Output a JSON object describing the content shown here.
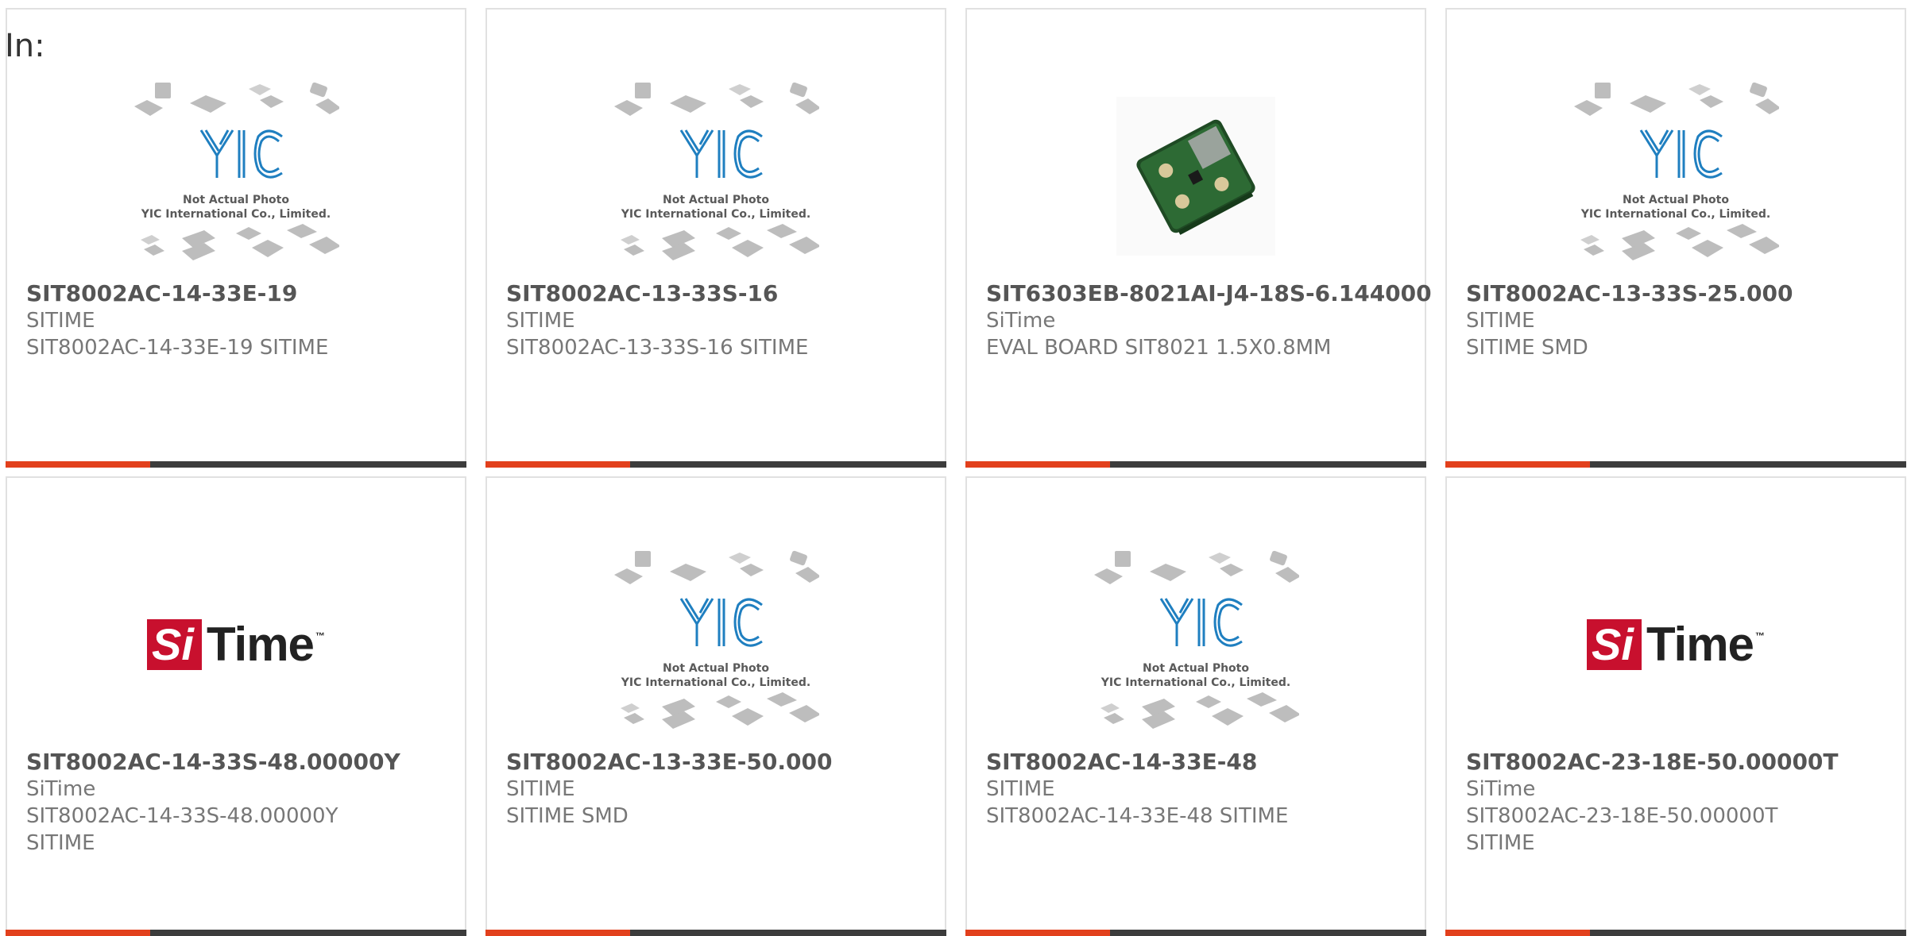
{
  "page": {
    "in_label": "In:"
  },
  "products": [
    {
      "part_number": "SIT8002AC-14-33E-19",
      "manufacturer": "SITIME",
      "description": "SIT8002AC-14-33E-19 SITIME",
      "image": "placeholder"
    },
    {
      "part_number": "SIT8002AC-13-33S-16",
      "manufacturer": "SITIME",
      "description": "SIT8002AC-13-33S-16 SITIME",
      "image": "placeholder"
    },
    {
      "part_number": "SIT6303EB-8021AI-J4-18S-6.144000",
      "manufacturer": "SiTime",
      "description": "EVAL BOARD SIT8021 1.5X0.8MM",
      "image": "eval-board"
    },
    {
      "part_number": "SIT8002AC-13-33S-25.000",
      "manufacturer": "SITIME",
      "description": "SITIME SMD",
      "image": "placeholder"
    },
    {
      "part_number": "SIT8002AC-14-33S-48.00000Y",
      "manufacturer": "SiTime",
      "description": "SIT8002AC-14-33S-48.00000Y SITIME",
      "image": "sitime-logo"
    },
    {
      "part_number": "SIT8002AC-13-33E-50.000",
      "manufacturer": "SITIME",
      "description": "SITIME SMD",
      "image": "placeholder"
    },
    {
      "part_number": "SIT8002AC-14-33E-48",
      "manufacturer": "SITIME",
      "description": "SIT8002AC-14-33E-48 SITIME",
      "image": "placeholder"
    },
    {
      "part_number": "SIT8002AC-23-18E-50.00000T",
      "manufacturer": "SiTime",
      "description": "SIT8002AC-23-18E-50.00000T SITIME",
      "image": "sitime-logo"
    }
  ],
  "placeholder_image": {
    "logo_text": "YIC",
    "caption_line1": "Not Actual Photo",
    "caption_line2": "YIC International Co., Limited."
  },
  "sitime_logo": {
    "si": "Si",
    "time": "Time",
    "tm": "™"
  },
  "colors": {
    "accent": "#e2401c",
    "bar_dark": "#3c3c3c",
    "card_border": "#e1e1e1",
    "logo_red": "#c8102e",
    "yic_blue": "#1f7fc0"
  }
}
